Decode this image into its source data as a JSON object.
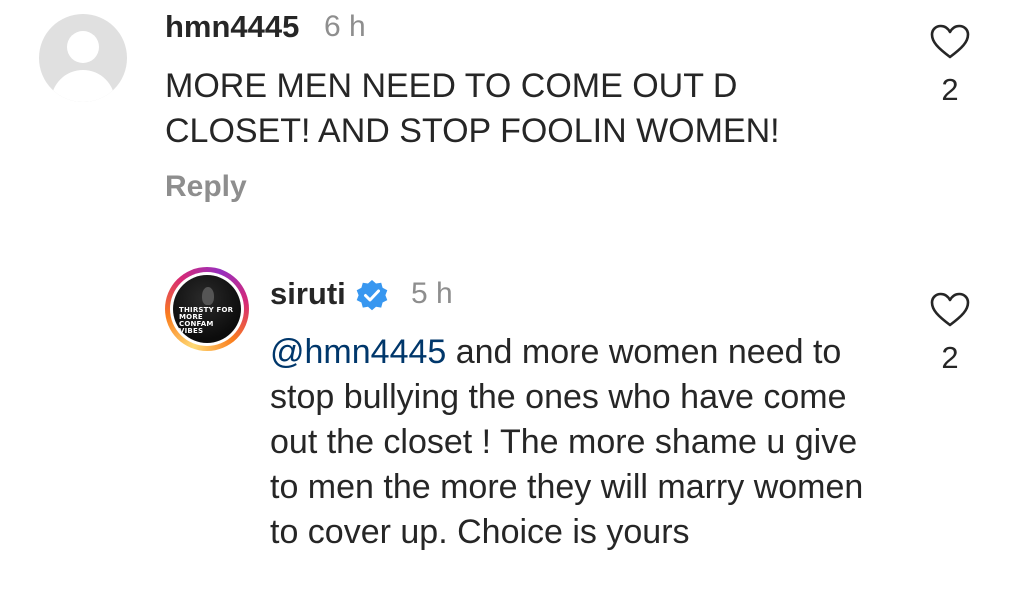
{
  "comments": [
    {
      "username": "hmn4445",
      "time": "6 h",
      "text": "MORE MEN NEED TO COME OUT D CLOSET! AND STOP FOOLIN WOMEN!",
      "reply_label": "Reply",
      "like_count": "2",
      "avatar": "default-avatar-icon"
    },
    {
      "username": "siruti",
      "verified": true,
      "time": "5 h",
      "mention": "@hmn4445",
      "text": " and more women need to stop bullying the ones who have come out the closet ! The more shame u give to men the more they will marry women to cover up. Choice is yours",
      "like_count": "2",
      "avatar_text": "THIRSTY FOR MORE CONFAM VIBES"
    }
  ],
  "colors": {
    "text": "#262626",
    "secondary": "#8e8e8e",
    "mention": "#00376b",
    "verified": "#3897f0"
  }
}
